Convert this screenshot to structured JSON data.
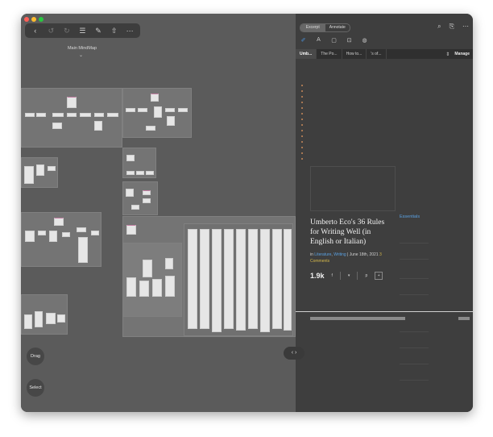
{
  "colors": {
    "window_bg": "#595959",
    "panel_bg": "#3e3e3e",
    "link": "#5aa0e0",
    "comments": "#d4b74a",
    "traffic_red": "#ff5f57",
    "traffic_yellow": "#febc2e",
    "traffic_green": "#28c840"
  },
  "toolbar": {
    "back_icon": "chevron-left-icon",
    "undo_icon": "undo-icon",
    "redo_icon": "redo-icon",
    "outline_icon": "list-icon",
    "edit_icon": "edit-icon",
    "share_icon": "share-icon",
    "more_icon": "ellipsis-icon"
  },
  "mindmap": {
    "title": "Main MindMap"
  },
  "left_buttons": {
    "drag": "Drag",
    "select": "Select"
  },
  "right_panel": {
    "segments": [
      "Excerpt",
      "Annotate"
    ],
    "tabs": [
      "Umb...",
      "The Po...",
      "How to...",
      "'s of..."
    ],
    "manage": "Manage",
    "article": {
      "title": "Umberto Eco's 36 Rules for Writing Well (in English or Italian)",
      "sidebar_link": "Essentials",
      "meta_in": "in",
      "cat1": "Literature",
      "cat2": "Writing",
      "date": "June 18th, 2021",
      "comments": "3 Comments",
      "share_count": "1.9k"
    }
  }
}
